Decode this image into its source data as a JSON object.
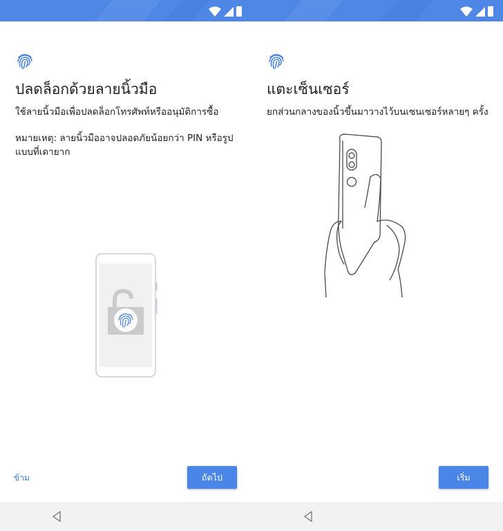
{
  "colors": {
    "status_bar": "#4f87e6",
    "accent": "#4a86e8",
    "nav_bar": "#f2f2f2",
    "text": "#202124"
  },
  "icons": {
    "status": [
      "wifi-icon",
      "signal-icon",
      "battery-icon"
    ],
    "header": "fingerprint-icon",
    "nav": "back-icon"
  },
  "screens": [
    {
      "title": "ปลดล็อกด้วยลายนิ้วมือ",
      "subtitle": "ใช้ลายนิ้วมือเพื่อปลดล็อกโทรศัพท์หรืออนุมัติการซื้อ",
      "note": "หมายเหตุ: ลายนิ้วมืออาจปลอดภัยน้อยกว่า PIN หรือรูปแบบที่เดายาก",
      "skip_label": "ข้าม",
      "next_label": "ถัดไป"
    },
    {
      "title": "แตะเซ็นเซอร์",
      "subtitle": "ยกส่วนกลางของนิ้วขึ้นมาวางไว้บนเซนเซอร์หลายๆ ครั้ง",
      "start_label": "เริ่ม"
    }
  ]
}
